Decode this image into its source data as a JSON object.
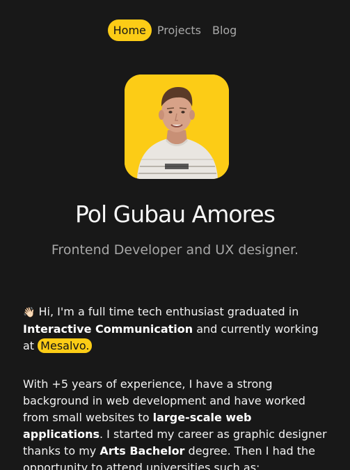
{
  "nav": {
    "items": [
      {
        "label": "Home",
        "active": true
      },
      {
        "label": "Projects",
        "active": false
      },
      {
        "label": "Blog",
        "active": false
      }
    ]
  },
  "profile": {
    "name": "Pol Gubau Amores",
    "role": "Frontend Developer and UX designer.",
    "avatar_bg": "#fccc16"
  },
  "intro": {
    "wave": "👋🏻",
    "text1": " Hi, I'm a full time tech enthusiast graduated in ",
    "bold1": "Interactive Communication",
    "text2": " and currently working at ",
    "company": "Mesalvo.",
    "text3": ""
  },
  "experience": {
    "text1": "With +5 years of experience, I have a strong background in web development and have worked from small websites to ",
    "bold1": "large-scale web applications",
    "text2": ". I started my career as graphic designer thanks to my ",
    "bold2": "Arts Bachelor",
    "text3": " degree. Then I had the opportunity to attend universities such as:"
  },
  "colors": {
    "accent": "#fccc16",
    "background": "#181818",
    "muted": "#a9a9a9"
  }
}
